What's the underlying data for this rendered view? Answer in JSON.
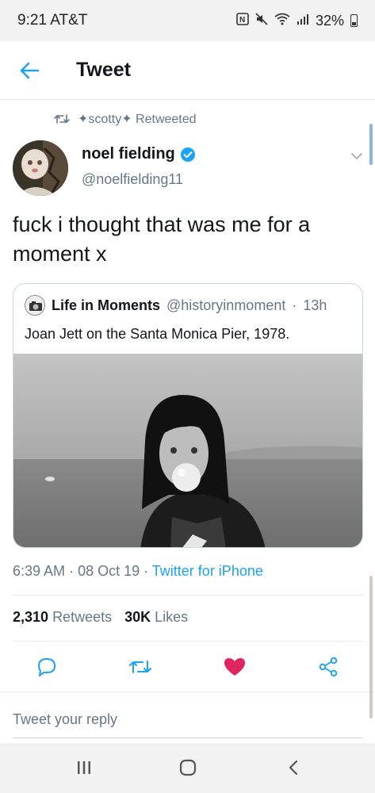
{
  "status_bar": {
    "time": "9:21 AT&T",
    "battery": "32%"
  },
  "header": {
    "title": "Tweet"
  },
  "retweet": {
    "text": "✦scotty✦ Retweeted"
  },
  "tweet": {
    "author_name": "noel fielding",
    "handle": "@noelfielding11",
    "text": "fuck i thought that was me for a moment x",
    "time": "6:39 AM",
    "date": "08 Oct 19",
    "source": "Twitter for iPhone",
    "retweets_count": "2,310",
    "retweets_label": "Retweets",
    "likes_count": "30K",
    "likes_label": "Likes"
  },
  "quoted_tweet": {
    "author_name": "Life in Moments",
    "handle": "@historyinmoment",
    "age": "13h",
    "text": "Joan Jett on the Santa Monica Pier, 1978."
  },
  "reply": {
    "placeholder": "Tweet your reply"
  },
  "icons": {
    "back": "back-arrow-icon",
    "retweet": "retweet-icon",
    "verified": "verified-badge-icon",
    "chevron": "chevron-down-icon",
    "reply": "reply-icon",
    "like": "heart-icon",
    "share": "share-icon"
  },
  "colors": {
    "accent": "#1da1f2",
    "like": "#e0245e",
    "muted": "#657786"
  }
}
